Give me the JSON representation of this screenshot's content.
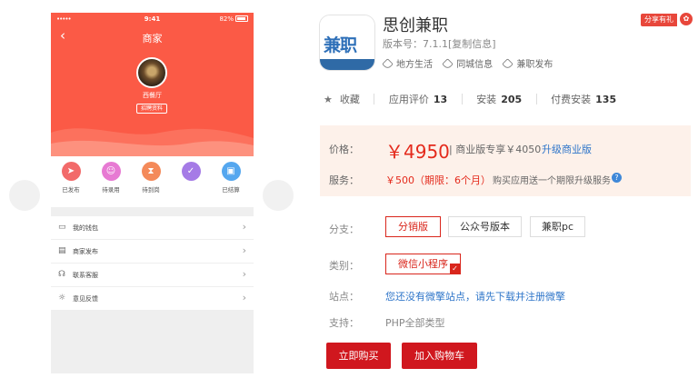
{
  "phone": {
    "status_signal": "•••••",
    "status_time": "9:41",
    "status_battery": "82%",
    "title": "商家",
    "shop_name": "西餐厅",
    "shop_button": "招聘资料",
    "quick_actions": [
      {
        "label": "已发布",
        "icon": "send-icon",
        "color": "#f26a6a"
      },
      {
        "label": "待录用",
        "icon": "person-icon",
        "color": "#e77ad3"
      },
      {
        "label": "待到岗",
        "icon": "hourglass-icon",
        "color": "#f48a5a"
      },
      {
        "label": "",
        "icon": "check-circle-icon",
        "color": "#a57be6"
      },
      {
        "label": "已结算",
        "icon": "wallet-icon",
        "color": "#55a7ef"
      }
    ],
    "menu": [
      {
        "label": "我的钱包",
        "icon": "wallet-icon"
      },
      {
        "label": "商家发布",
        "icon": "publish-icon"
      },
      {
        "label": "联系客服",
        "icon": "headset-icon"
      },
      {
        "label": "意见反馈",
        "icon": "bulb-icon"
      }
    ]
  },
  "product": {
    "icon_text": "兼职",
    "name": "思创兼职",
    "version": "版本号：7.1.1[复制信息]",
    "tags": [
      "地方生活",
      "同城信息",
      "兼职发布"
    ],
    "share_label": "分享有礼",
    "gift_icon": "gift-icon",
    "stats": {
      "favorite_label": "收藏",
      "rating_label": "应用评价",
      "rating_count": "13",
      "installs_label": "安装",
      "installs_count": "205",
      "paid_installs_label": "付费安装",
      "paid_installs_count": "135"
    },
    "price": {
      "label": "价格：",
      "main": "￥4950",
      "standard": "| 商业版专享￥4050",
      "upgrade": "升级商业版"
    },
    "service": {
      "label": "服务：",
      "price": "￥500（期限：6个月）",
      "note": "购买应用送一个期限升级服务",
      "help_icon": "?"
    },
    "branch": {
      "label": "分支：",
      "options": [
        "分销版",
        "公众号版本",
        "兼职pc"
      ],
      "selected": "分销版"
    },
    "category": {
      "label": "类别：",
      "options": [
        "微信小程序"
      ],
      "selected": "微信小程序"
    },
    "site": {
      "label": "站点：",
      "link": "您还没有微擎站点，请先下载并注册微擎"
    },
    "support": {
      "label": "支持：",
      "value": "PHP全部类型"
    },
    "buy_now": "立即购买",
    "add_to_cart": "加入购物车",
    "accent_color": "#d0171e",
    "link_color": "#2e75c9"
  }
}
